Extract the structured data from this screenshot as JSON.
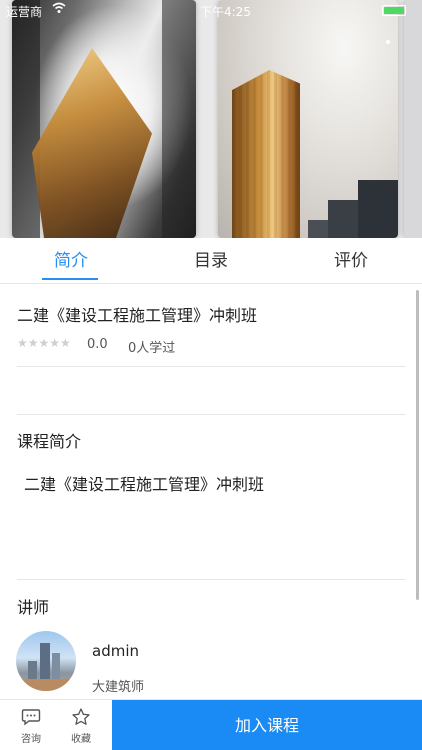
{
  "status_bar": {
    "carrier": "运营商",
    "time": "下午4:25"
  },
  "tabs": [
    {
      "label": "简介",
      "active": true
    },
    {
      "label": "目录",
      "active": false
    },
    {
      "label": "评价",
      "active": false
    }
  ],
  "course": {
    "title": "二建《建设工程施工管理》冲刺班",
    "rating_stars": "★★★★★",
    "score": "0.0",
    "learners": "0人学过"
  },
  "intro": {
    "heading": "课程简介",
    "text": "二建《建设工程施工管理》冲刺班"
  },
  "teacher": {
    "heading": "讲师",
    "name": "admin",
    "title": "大建筑师"
  },
  "bottom_bar": {
    "consult_label": "咨询",
    "favorite_label": "收藏",
    "join_label": "加入课程"
  },
  "colors": {
    "accent": "#2a8df0",
    "join_button": "#1a8bf5",
    "battery": "#4cd964"
  }
}
